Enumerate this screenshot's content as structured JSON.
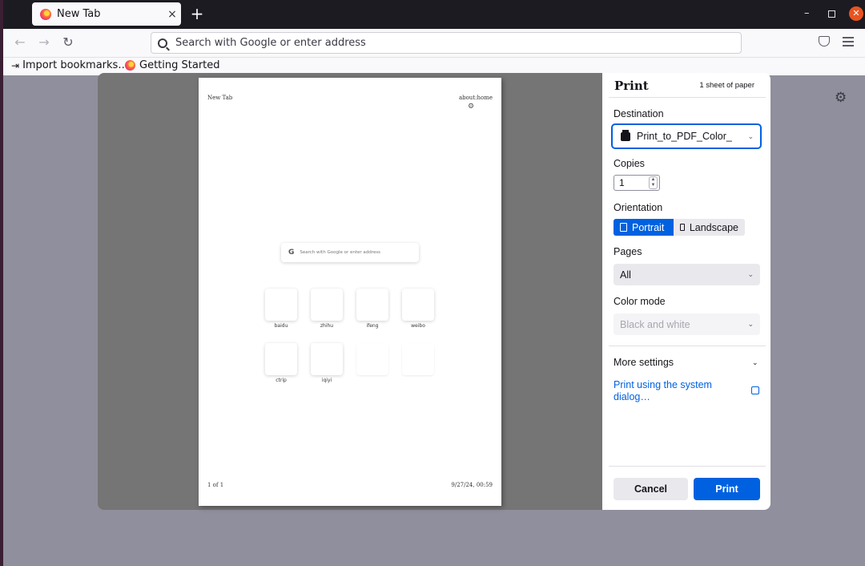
{
  "browser": {
    "tab_title": "New Tab",
    "tab_close": "×",
    "new_tab": "+",
    "url_placeholder": "Search with Google or enter address",
    "bookmarks": [
      {
        "label": "Import bookmarks…",
        "icon": "import-icon"
      },
      {
        "label": "Getting Started",
        "icon": "firefox-icon"
      }
    ]
  },
  "preview": {
    "header_left": "New Tab",
    "header_right": "about:home",
    "search_placeholder": "Search with Google or enter address",
    "search_glyph": "G",
    "tiles": [
      "baidu",
      "zhihu",
      "ifeng",
      "weibo",
      "ctrip",
      "iqiyi",
      "",
      ""
    ],
    "footer_left": "1 of 1",
    "footer_right": "9/27/24, 00:59"
  },
  "print": {
    "title": "Print",
    "sheets": "1 sheet of paper",
    "destination_label": "Destination",
    "destination_value": "Print_to_PDF_Color_",
    "copies_label": "Copies",
    "copies_value": "1",
    "orientation_label": "Orientation",
    "portrait": "Portrait",
    "landscape": "Landscape",
    "pages_label": "Pages",
    "pages_value": "All",
    "color_label": "Color mode",
    "color_value": "Black and white",
    "more_settings": "More settings",
    "system_dialog": "Print using the system dialog…",
    "cancel": "Cancel",
    "print": "Print"
  },
  "colors": {
    "accent": "#0061e0",
    "toolbar": "#f9f9fb",
    "tabbar": "#1c1b22",
    "backdrop": "#8f8f9d"
  }
}
